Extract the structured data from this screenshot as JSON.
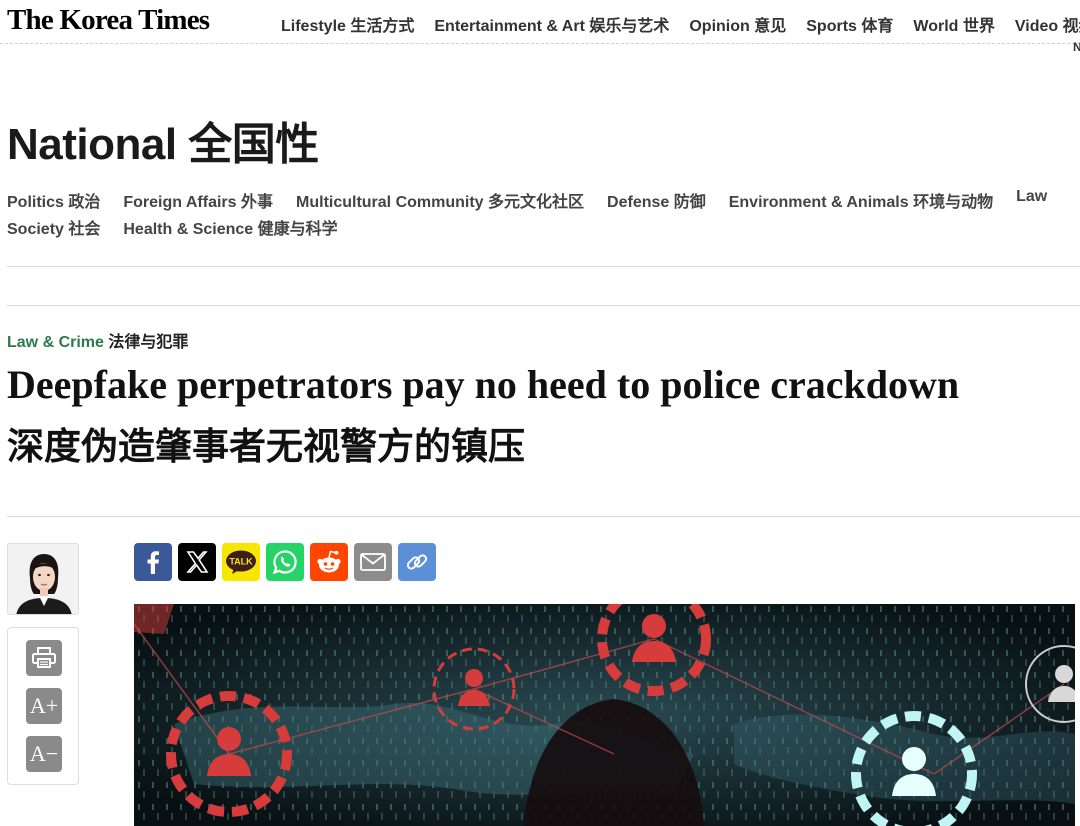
{
  "brand": {
    "logo": "The Korea Times"
  },
  "topnav": [
    "Lifestyle 生活方式",
    "Entertainment & Art 娱乐与艺术",
    "Opinion 意见",
    "Sports 体育",
    "World 世界",
    "Video 视频"
  ],
  "topnav_overflow": "N",
  "section": {
    "title": "National 全国性",
    "subnav_row1": [
      "Politics 政治",
      "Foreign Affairs 外事",
      "Multicultural Community 多元文化社区",
      "Defense 防御",
      "Environment & Animals 环境与动物",
      "Law"
    ],
    "subnav_row2": [
      "Society 社会",
      "Health & Science 健康与科学"
    ]
  },
  "article": {
    "category_en": "Law & Crime",
    "category_zh": "法律与犯罪",
    "headline": "Deepfake perpetrators pay no heed to police crackdown",
    "headline_zh": "深度伪造肇事者无视警方的镇压"
  },
  "share_icons": [
    "facebook-icon",
    "x-icon",
    "kakaotalk-icon",
    "whatsapp-icon",
    "reddit-icon",
    "email-icon",
    "link-icon"
  ],
  "share_labels": {
    "kakao": "TALK"
  },
  "tools": {
    "print": "print-icon",
    "font_up": "A+",
    "font_down": "A−"
  },
  "colors": {
    "kicker": "#2d7a4c",
    "facebook": "#3b5998",
    "x": "#000000",
    "kakao": "#f7e600",
    "whatsapp": "#25d366",
    "reddit": "#ff4500",
    "email": "#8c8c8c",
    "link": "#5b8fd6"
  }
}
